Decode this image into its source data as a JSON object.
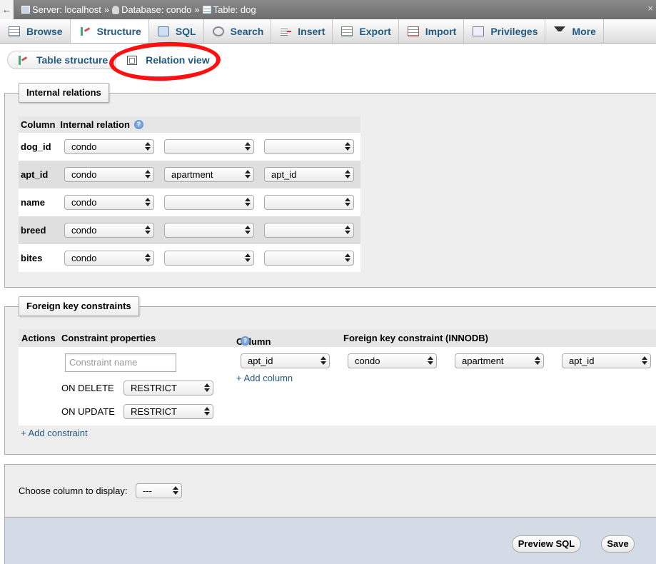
{
  "breadcrumb": {
    "back": "←",
    "server": "Server: localhost",
    "sep": "»",
    "database": "Database: condo",
    "table": "Table: dog",
    "close": "×"
  },
  "tabs": [
    {
      "label": "Browse",
      "icon": "browse-icon"
    },
    {
      "label": "Structure",
      "icon": "structure-icon"
    },
    {
      "label": "SQL",
      "icon": "sql-icon"
    },
    {
      "label": "Search",
      "icon": "search-icon"
    },
    {
      "label": "Insert",
      "icon": "insert-icon"
    },
    {
      "label": "Export",
      "icon": "export-icon"
    },
    {
      "label": "Import",
      "icon": "import-icon"
    },
    {
      "label": "Privileges",
      "icon": "privileges-icon"
    },
    {
      "label": "More",
      "icon": "chevron-down-icon"
    }
  ],
  "subtabs": {
    "table_structure": "Table structure",
    "relation_view": "Relation view"
  },
  "internal_relations": {
    "legend": "Internal relations",
    "header_column": "Column",
    "header_relation": "Internal relation",
    "help": "?",
    "rows": [
      {
        "column": "dog_id",
        "db": "condo",
        "table": "",
        "field": ""
      },
      {
        "column": "apt_id",
        "db": "condo",
        "table": "apartment",
        "field": "apt_id"
      },
      {
        "column": "name",
        "db": "condo",
        "table": "",
        "field": ""
      },
      {
        "column": "breed",
        "db": "condo",
        "table": "",
        "field": ""
      },
      {
        "column": "bites",
        "db": "condo",
        "table": "",
        "field": ""
      }
    ]
  },
  "foreign_keys": {
    "legend": "Foreign key constraints",
    "header_actions": "Actions",
    "header_props": "Constraint properties",
    "header_column": "Column",
    "header_fk": "Foreign key constraint (INNODB)",
    "help": "?",
    "constraint_placeholder": "Constraint name",
    "on_delete_label": "ON DELETE",
    "on_delete_value": "RESTRICT",
    "on_update_label": "ON UPDATE",
    "on_update_value": "RESTRICT",
    "column_value": "apt_id",
    "add_column": "+ Add column",
    "ref_db": "condo",
    "ref_table": "apartment",
    "ref_column": "apt_id",
    "add_constraint": "+ Add constraint"
  },
  "display": {
    "label": "Choose column to display:",
    "value": "---"
  },
  "footer": {
    "preview_sql": "Preview SQL",
    "save": "Save"
  }
}
